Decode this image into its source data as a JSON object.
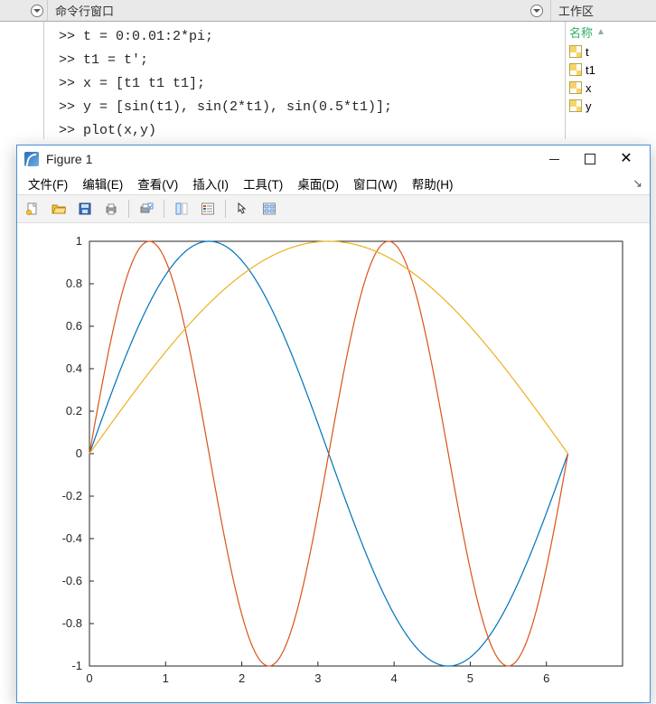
{
  "panels": {
    "command_window_title": "命令行窗口",
    "workspace_title": "工作区",
    "workspace_col_name": "名称"
  },
  "command_history": [
    ">> t = 0:0.01:2*pi;",
    ">> t1 = t';",
    ">> x = [t1 t1 t1];",
    ">> y = [sin(t1), sin(2*t1), sin(0.5*t1)];",
    ">> plot(x,y)"
  ],
  "workspace_vars": [
    "t",
    "t1",
    "x",
    "y"
  ],
  "figure": {
    "title": "Figure 1",
    "menus": [
      "文件(F)",
      "编辑(E)",
      "查看(V)",
      "插入(I)",
      "工具(T)",
      "桌面(D)",
      "窗口(W)",
      "帮助(H)"
    ],
    "toolbar": [
      "new",
      "open",
      "save",
      "print",
      "|",
      "figprint",
      "|",
      "datacursor",
      "legend",
      "|",
      "arrow",
      "linked"
    ]
  },
  "chart_data": {
    "type": "line",
    "title": "",
    "xlabel": "",
    "ylabel": "",
    "xlim": [
      0,
      7
    ],
    "ylim": [
      -1,
      1
    ],
    "xticks": [
      0,
      1,
      2,
      3,
      4,
      5,
      6
    ],
    "yticks": [
      -1,
      -0.8,
      -0.6,
      -0.4,
      -0.2,
      0,
      0.2,
      0.4,
      0.6,
      0.8,
      1
    ],
    "x_generator": "0:0.01:2*pi",
    "series": [
      {
        "name": "sin(t)",
        "expr": "sin(x)",
        "color": "#0072BD"
      },
      {
        "name": "sin(2*t)",
        "expr": "sin(2*x)",
        "color": "#D95319"
      },
      {
        "name": "sin(0.5*t)",
        "expr": "sin(0.5*x)",
        "color": "#EDB120"
      }
    ]
  }
}
